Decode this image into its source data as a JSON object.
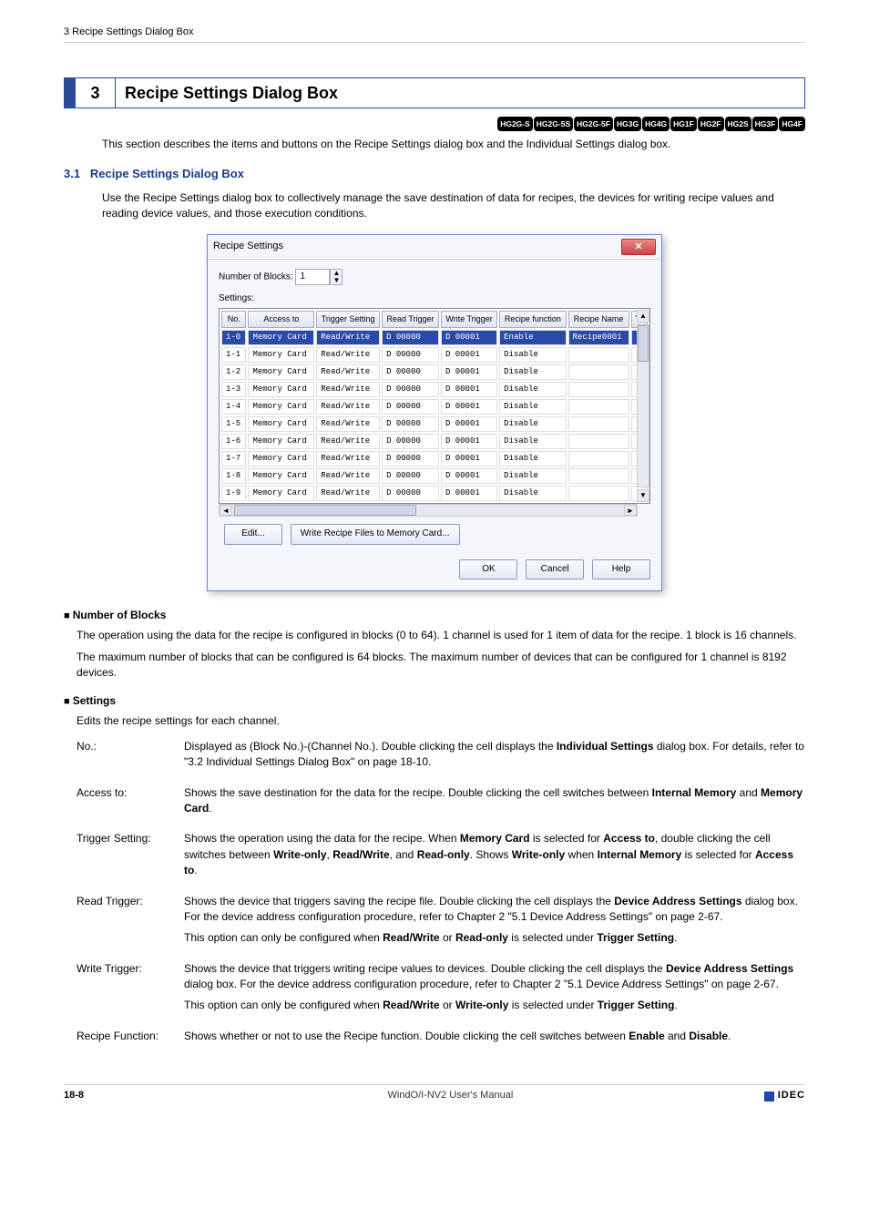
{
  "header_line": "3 Recipe Settings Dialog Box",
  "chapter": {
    "num": "3",
    "title": "Recipe Settings Dialog Box"
  },
  "badges": [
    "HG2G-S",
    "HG2G-5S",
    "HG2G-5F",
    "HG3G",
    "HG4G",
    "HG1F",
    "HG2F",
    "HG2S",
    "HG3F",
    "HG4F"
  ],
  "intro": "This section describes the items and buttons on the Recipe Settings dialog box and the Individual Settings dialog box.",
  "sub31": {
    "num": "3.1",
    "title": "Recipe Settings Dialog Box"
  },
  "sub31_intro": "Use the Recipe Settings dialog box to collectively manage the save destination of data for recipes, the devices for writing recipe values and reading device values, and those execution conditions.",
  "dialog": {
    "title": "Recipe Settings",
    "blocks_label": "Number of Blocks:",
    "blocks_value": "1",
    "settings_label": "Settings:",
    "columns": [
      "No.",
      "Access to",
      "Trigger Setting",
      "Read Trigger",
      "Write Trigger",
      "Recipe function",
      "Recipe Name",
      "To"
    ],
    "rows": [
      {
        "no": "1-0",
        "acc": "Memory Card",
        "trig": "Read/Write",
        "rt": "D 00000",
        "wt": "D 00001",
        "rf": "Enable",
        "rn": "Recipe0001",
        "to": "",
        "sel": true
      },
      {
        "no": "1-1",
        "acc": "Memory Card",
        "trig": "Read/Write",
        "rt": "D 00000",
        "wt": "D 00001",
        "rf": "Disable",
        "rn": "",
        "to": ""
      },
      {
        "no": "1-2",
        "acc": "Memory Card",
        "trig": "Read/Write",
        "rt": "D 00000",
        "wt": "D 00001",
        "rf": "Disable",
        "rn": "",
        "to": ""
      },
      {
        "no": "1-3",
        "acc": "Memory Card",
        "trig": "Read/Write",
        "rt": "D 00000",
        "wt": "D 00001",
        "rf": "Disable",
        "rn": "",
        "to": ""
      },
      {
        "no": "1-4",
        "acc": "Memory Card",
        "trig": "Read/Write",
        "rt": "D 00000",
        "wt": "D 00001",
        "rf": "Disable",
        "rn": "",
        "to": ""
      },
      {
        "no": "1-5",
        "acc": "Memory Card",
        "trig": "Read/Write",
        "rt": "D 00000",
        "wt": "D 00001",
        "rf": "Disable",
        "rn": "",
        "to": ""
      },
      {
        "no": "1-6",
        "acc": "Memory Card",
        "trig": "Read/Write",
        "rt": "D 00000",
        "wt": "D 00001",
        "rf": "Disable",
        "rn": "",
        "to": ""
      },
      {
        "no": "1-7",
        "acc": "Memory Card",
        "trig": "Read/Write",
        "rt": "D 00000",
        "wt": "D 00001",
        "rf": "Disable",
        "rn": "",
        "to": ""
      },
      {
        "no": "1-8",
        "acc": "Memory Card",
        "trig": "Read/Write",
        "rt": "D 00000",
        "wt": "D 00001",
        "rf": "Disable",
        "rn": "",
        "to": ""
      },
      {
        "no": "1-9",
        "acc": "Memory Card",
        "trig": "Read/Write",
        "rt": "D 00000",
        "wt": "D 00001",
        "rf": "Disable",
        "rn": "",
        "to": ""
      }
    ],
    "edit": "Edit...",
    "write_btn": "Write Recipe Files to Memory Card...",
    "ok": "OK",
    "cancel": "Cancel",
    "help": "Help"
  },
  "num_blocks_head": "Number of Blocks",
  "num_blocks_p1": "The operation using the data for the recipe is configured in blocks (0 to 64). 1 channel is used for 1 item of data for the recipe. 1 block is 16 channels.",
  "num_blocks_p2": "The maximum number of blocks that can be configured is 64 blocks. The maximum number of devices that can be configured for 1 channel is 8192 devices.",
  "settings_head": "Settings",
  "settings_lead": "Edits the recipe settings for each channel.",
  "defs": {
    "no_term": "No.:",
    "no_desc_a": "Displayed as (Block No.)-(Channel No.). Double clicking the cell displays the ",
    "no_desc_b": "Individual Settings",
    "no_desc_c": " dialog box. For details, refer to \"3.2 Individual Settings Dialog Box\" on page 18-10.",
    "acc_term": "Access to:",
    "acc_a": "Shows the save destination for the data for the recipe. Double clicking the cell switches between ",
    "acc_b": "Internal Memory",
    "acc_c": " and ",
    "acc_d": "Memory Card",
    "acc_e": ".",
    "ts_term": "Trigger Setting:",
    "ts_a": "Shows the operation using the data for the recipe. When ",
    "ts_b": "Memory Card",
    "ts_c": " is selected for ",
    "ts_d": "Access to",
    "ts_e": ", double clicking the cell switches between ",
    "ts_f": "Write-only",
    "ts_g": ", ",
    "ts_h": "Read/Write",
    "ts_i": ", and ",
    "ts_j": "Read-only",
    "ts_k": ".",
    "ts_l": "Shows ",
    "ts_m": "Write-only",
    "ts_n": " when ",
    "ts_o": "Internal Memory",
    "ts_p": " is selected for ",
    "ts_q": "Access to",
    "ts_r": ".",
    "rt_term": "Read Trigger:",
    "rt_a": "Shows the device that triggers saving the recipe file. Double clicking the cell displays the ",
    "rt_b": "Device Address Settings",
    "rt_c": " dialog box. For the device address configuration procedure, refer to Chapter 2 \"5.1 Device Address Settings\" on page 2-67.",
    "rt_d": "This option can only be configured when ",
    "rt_e": "Read/Write",
    "rt_f": " or ",
    "rt_g": "Read-only",
    "rt_h": " is selected under ",
    "rt_i": "Trigger Setting",
    "rt_j": ".",
    "wt_term": "Write Trigger:",
    "wt_a": "Shows the device that triggers writing recipe values to devices. Double clicking the cell displays the ",
    "wt_b": "Device Address Settings",
    "wt_c": " dialog box. For the device address configuration procedure, refer to Chapter 2 \"5.1 Device Address Settings\" on page 2-67.",
    "wt_d": "This option can only be configured when ",
    "wt_e": "Read/Write",
    "wt_f": " or ",
    "wt_g": "Write-only",
    "wt_h": " is selected under ",
    "wt_i": "Trigger Setting",
    "wt_j": ".",
    "rf_term": "Recipe Function:",
    "rf_a": "Shows whether or not to use the Recipe function. Double clicking the cell switches between ",
    "rf_b": "Enable",
    "rf_c": " and ",
    "rf_d": "Disable",
    "rf_e": "."
  },
  "footer": {
    "pg": "18-8",
    "title": "WindO/I-NV2 User's Manual",
    "brand": "IDEC"
  }
}
